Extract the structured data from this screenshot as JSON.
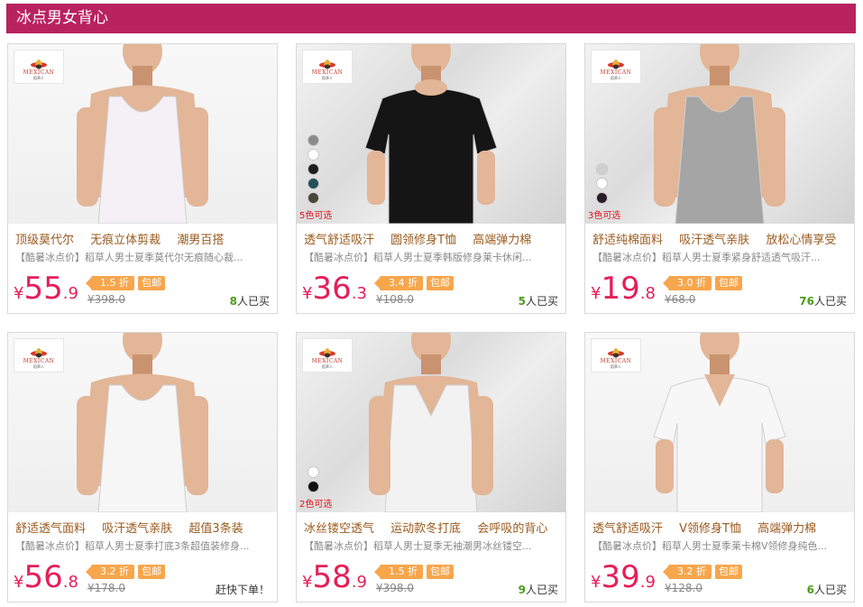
{
  "section_title": "冰点男女背心",
  "brand": {
    "logo_text": "MEXICAN",
    "logo_sub": "稻草人"
  },
  "products": [
    {
      "tags": [
        "顶级莫代尔",
        "无痕立体剪裁",
        "潮男百搭"
      ],
      "desc": "【酷暑冰点价】稻草人男士夏季莫代尔无痕随心裁...",
      "price_int": "55",
      "price_dec": ".9",
      "discount": "1.5 折",
      "shipping": "包邮",
      "orig_price": "¥398.0",
      "sold_count": "8",
      "sold_label": "人已买",
      "garment": "tank",
      "garment_color": "#f4f0f6",
      "bg": "plain",
      "swatches": [],
      "color_count": ""
    },
    {
      "tags": [
        "透气舒适吸汗",
        "圆领修身T恤",
        "高端弹力棉"
      ],
      "desc": "【酷暑冰点价】稻草人男士夏季韩版修身莱卡休闲...",
      "price_int": "36",
      "price_dec": ".3",
      "discount": "3.4 折",
      "shipping": "包邮",
      "orig_price": "¥108.0",
      "sold_count": "5",
      "sold_label": "人已买",
      "garment": "tee",
      "garment_color": "#151515",
      "bg": "poly",
      "swatches": [
        "#8a8a8a",
        "#ffffff",
        "#1e1e1e",
        "#24505a",
        "#4a4638"
      ],
      "color_count": "5色可选"
    },
    {
      "tags": [
        "舒适纯棉面料",
        "吸汗透气亲肤",
        "放松心情享受"
      ],
      "desc": "【酷暑冰点价】稻草人男士夏季紧身舒适透气吸汗...",
      "price_int": "19",
      "price_dec": ".8",
      "discount": "3.0 折",
      "shipping": "包邮",
      "orig_price": "¥68.0",
      "sold_count": "76",
      "sold_label": "人已买",
      "garment": "tank",
      "garment_color": "#a5a5a5",
      "bg": "poly",
      "swatches": [
        "#cfcfcf",
        "#ffffff",
        "#2a1e2a"
      ],
      "color_count": "3色可选"
    },
    {
      "tags": [
        "舒适透气面料",
        "吸汗透气亲肤",
        "超值3条装"
      ],
      "desc": "【酷暑冰点价】稻草人男士夏季打底3条超值装修身...",
      "price_int": "56",
      "price_dec": ".8",
      "discount": "3.2 折",
      "shipping": "包邮",
      "orig_price": "¥178.0",
      "sold_count": "",
      "sold_label": "赶快下单！",
      "garment": "tank",
      "garment_color": "#f6f6f6",
      "bg": "plain",
      "swatches": [],
      "color_count": ""
    },
    {
      "tags": [
        "冰丝镂空透气",
        "运动款冬打底",
        "会呼吸的背心"
      ],
      "desc": "【酷暑冰点价】稻草人男士夏季无袖潮男冰丝镂空...",
      "price_int": "58",
      "price_dec": ".9",
      "discount": "1.5 折",
      "shipping": "包邮",
      "orig_price": "¥398.0",
      "sold_count": "9",
      "sold_label": "人已买",
      "garment": "vest",
      "garment_color": "#f2f2f2",
      "bg": "poly",
      "swatches": [
        "#ffffff",
        "#111111"
      ],
      "color_count": "2色可选"
    },
    {
      "tags": [
        "透气舒适吸汗",
        "V领修身T恤",
        "高端弹力棉"
      ],
      "desc": "【酷暑冰点价】稻草人男士夏季莱卡棉V领修身纯色...",
      "price_int": "39",
      "price_dec": ".9",
      "discount": "3.2 折",
      "shipping": "包邮",
      "orig_price": "¥128.0",
      "sold_count": "6",
      "sold_label": "人已买",
      "garment": "vtee",
      "garment_color": "#f7f7f7",
      "bg": "plain",
      "swatches": [],
      "color_count": ""
    }
  ]
}
